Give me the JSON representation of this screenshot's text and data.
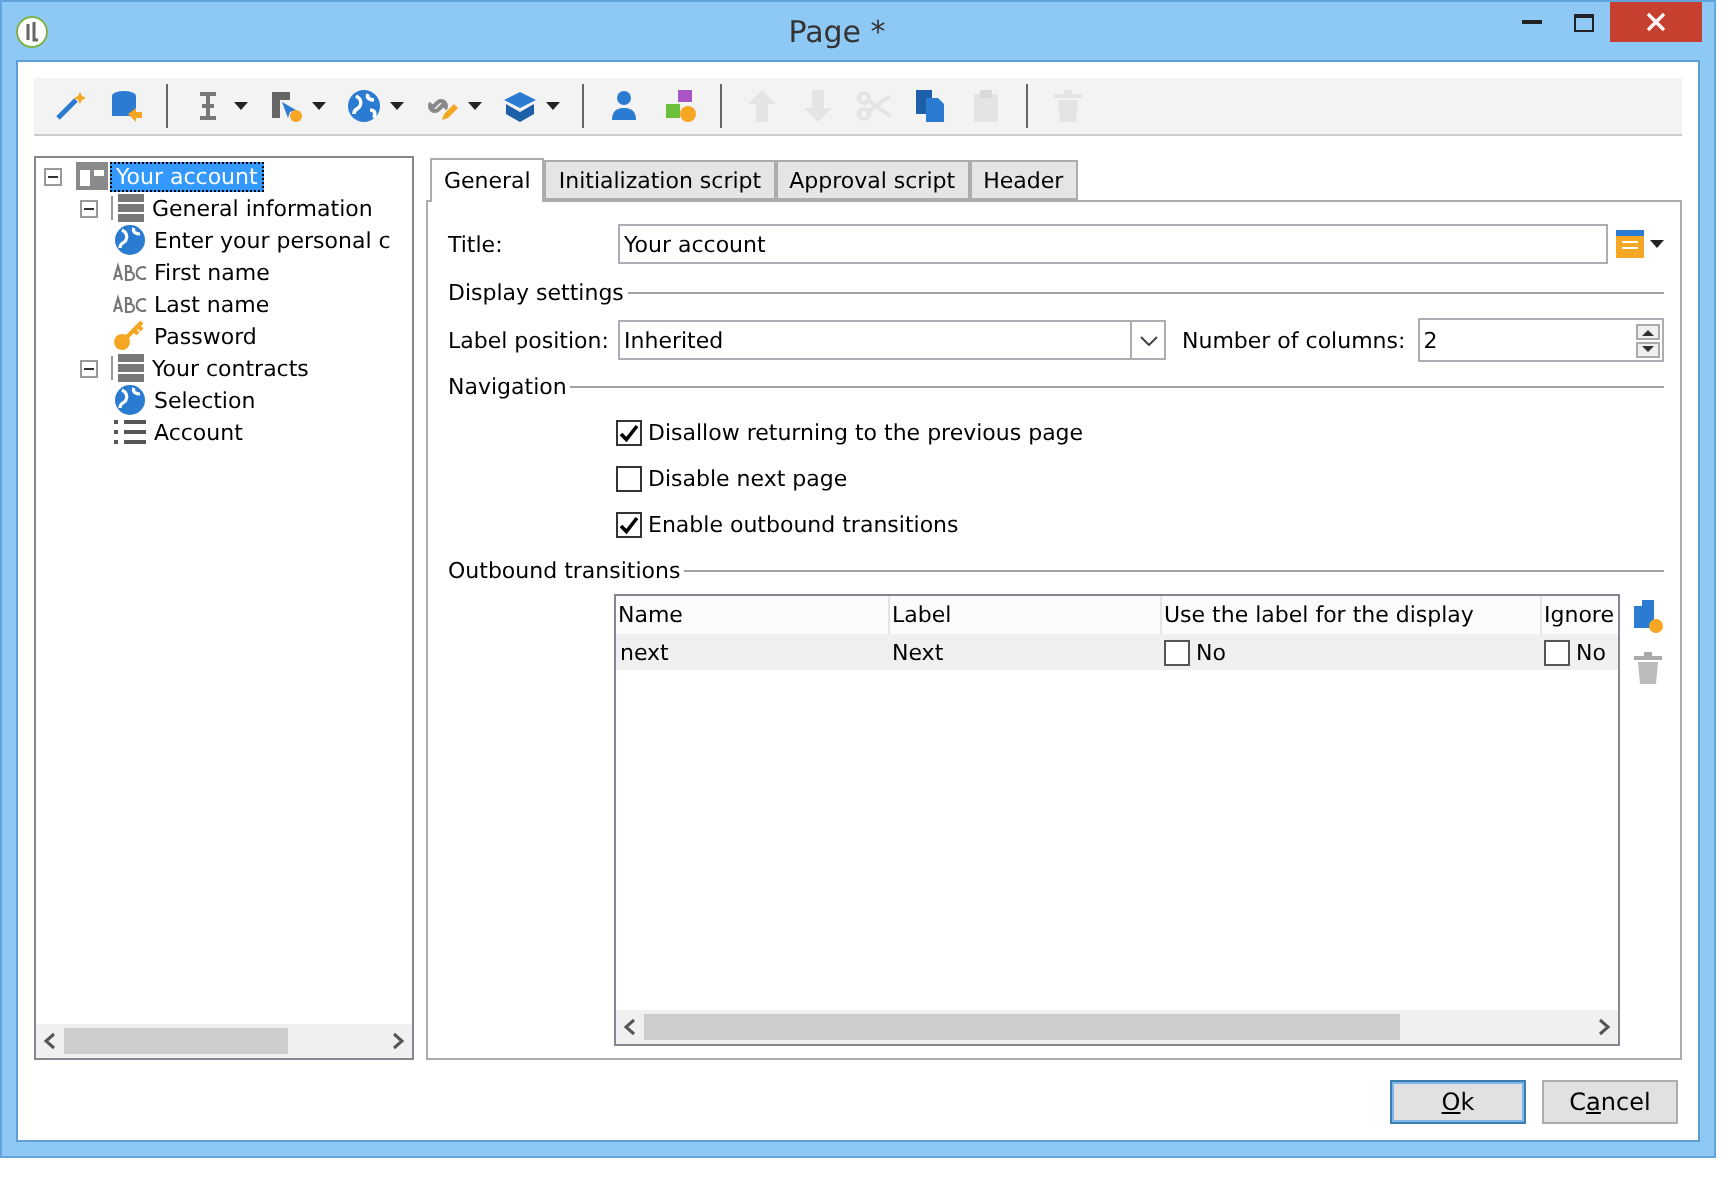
{
  "window": {
    "title": "Page *"
  },
  "toolbar": [
    {
      "kind": "wand",
      "disabled": false
    },
    {
      "kind": "database",
      "disabled": false
    },
    {
      "kind": "separator"
    },
    {
      "kind": "cursor",
      "disabled": false,
      "dropdown": true
    },
    {
      "kind": "select",
      "disabled": false,
      "dropdown": true
    },
    {
      "kind": "globe",
      "disabled": false,
      "dropdown": true
    },
    {
      "kind": "link",
      "disabled": false,
      "dropdown": true
    },
    {
      "kind": "box",
      "disabled": false,
      "dropdown": true
    },
    {
      "kind": "separator"
    },
    {
      "kind": "person",
      "disabled": false
    },
    {
      "kind": "shapes",
      "disabled": false
    },
    {
      "kind": "separator"
    },
    {
      "kind": "up",
      "disabled": true
    },
    {
      "kind": "down",
      "disabled": true
    },
    {
      "kind": "scissors",
      "disabled": true
    },
    {
      "kind": "copy",
      "disabled": false
    },
    {
      "kind": "paste",
      "disabled": true
    },
    {
      "kind": "separator"
    },
    {
      "kind": "trash",
      "disabled": true
    }
  ],
  "tree": [
    {
      "label": "Your account",
      "kind": "page",
      "selected": true,
      "expanded": true,
      "children": [
        {
          "label": "General information",
          "kind": "group",
          "selected": false,
          "expanded": true,
          "children": [
            {
              "label": "Enter your personal c",
              "kind": "globe",
              "selected": false
            },
            {
              "label": "First name",
              "kind": "text",
              "selected": false
            },
            {
              "label": "Last name",
              "kind": "text",
              "selected": false
            },
            {
              "label": "Password",
              "kind": "password",
              "selected": false
            }
          ]
        },
        {
          "label": "Your contracts",
          "kind": "group",
          "selected": false,
          "expanded": true,
          "children": [
            {
              "label": "Selection",
              "kind": "globe",
              "selected": false
            },
            {
              "label": "Account",
              "kind": "list",
              "selected": false
            }
          ]
        }
      ]
    }
  ],
  "tabs": [
    {
      "label": "General",
      "selected": true
    },
    {
      "label": "Initialization script",
      "selected": false
    },
    {
      "label": "Approval script",
      "selected": false
    },
    {
      "label": "Header",
      "selected": false
    }
  ],
  "title_field": {
    "label": "Title:",
    "value": "Your account"
  },
  "display_settings": {
    "heading": "Display settings",
    "label_position": {
      "label": "Label position:",
      "value": "Inherited"
    },
    "columns": {
      "label": "Number of columns:",
      "value": "2"
    }
  },
  "navigation": {
    "heading": "Navigation",
    "options": [
      {
        "label": "Disallow returning to the previous page",
        "checked": true
      },
      {
        "label": "Disable next page",
        "checked": false
      },
      {
        "label": "Enable outbound transitions",
        "checked": true
      }
    ]
  },
  "outbound": {
    "heading": "Outbound transitions",
    "columns": [
      "Name",
      "Label",
      "Use the label for the display",
      "Ignore"
    ],
    "rows": [
      {
        "name": "next",
        "label": "Next",
        "use_label": {
          "checked": false,
          "text": "No"
        },
        "ignore": {
          "checked": false,
          "text": "No"
        },
        "selected": true
      }
    ]
  },
  "buttons": [
    {
      "access_key": "O",
      "after": "k",
      "default": true
    },
    {
      "before": "C",
      "access_key": "a",
      "after": "ncel",
      "default": false
    }
  ]
}
